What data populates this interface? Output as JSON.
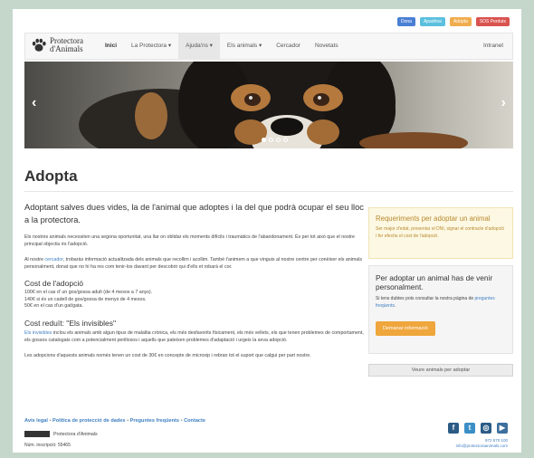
{
  "top_pills": [
    {
      "label": "Dona",
      "color": "#4a7fd4"
    },
    {
      "label": "Apadrina",
      "color": "#5bc0de"
    },
    {
      "label": "Adopta",
      "color": "#f0ad4e"
    },
    {
      "label": "SOS Perduts",
      "color": "#d9534f"
    }
  ],
  "brand": {
    "line1": "Protectora",
    "line2": "d'Animals"
  },
  "nav": {
    "items": [
      "Inici",
      "La Protectora ▾",
      "Ajuda'ns ▾",
      "Els animals ▾",
      "Cercador",
      "Novetats"
    ],
    "right": "Intranet"
  },
  "hero": {
    "prev": "‹",
    "next": "›"
  },
  "page_title": "Adopta",
  "main": {
    "lead": "Adoptant salves dues vides, la de l'animal que adoptes i la del que podrà ocupar el seu lloc a la protectora.",
    "intro": "Els nostres animals necessiten una segona oportunitat, una llar on oblidar els moments difícils i traumàtics de l'abandonament. És per tot això que el nostre principal objectiu és l'adopció.",
    "search_p_before": "Al nostre",
    "search_link": "cercador",
    "search_p_after": ", trobaràs informació actualitzada dels animals que recollim i acollim. També t'animem a que vinguis al nostre centre per conèixer els animals personalment, donat que no hi ha res com tenir-los davant per descobrir qui d'ells et robarà el cor.",
    "cost_title": "Cost de l'adopció",
    "cost_lines": [
      "100€ en el cas d' un gos/gossa adult (de 4 mesos a 7 anys).",
      "140€ si és un cadell de gos/gossa de menys de 4 mesos.",
      "50€ en el cas d'un gat/gata."
    ],
    "invisible_title": "Cost reduït: \"Els invisibles\"",
    "invisible_link": "Els invisibles",
    "invisible_text": " inclou els animals amb algun tipus de malaltia crònica, els més desfavorits físicament, els més vellets, els que tenen problemes de comportament, els gossos catalogats com a potencialment perillosos i aquells que pateixen problemes d'adaptació i urgeix la seva adopció.",
    "invisible_cost": "Les adopcions d'aquests animals només tenen un cost de 30€ en concepte de microxip i rebran tot el suport que calgui per part nostre."
  },
  "requirements": {
    "title": "Requeriments per adoptar un animal",
    "body": "Ser major d'edat, presentar el DNI, signar el contracte d'adopció i fer efectiu el cost de l'adopció."
  },
  "adopt_panel": {
    "title": "Per adoptar un animal has de venir personalment.",
    "body_before": "Si tens dubtes pots consultar la nostra pàgina de ",
    "body_link": "preguntes freqüents",
    "body_after": ".",
    "button": "Demanar informació"
  },
  "see_animals_button": "Veure animals per adoptar",
  "footer": {
    "links": [
      "Avís legal",
      "Política de protecció de dades",
      "Preguntes freqüents",
      "Contacte"
    ],
    "org": "Protectora d'Animals",
    "reg": "Núm. inscripció: 55465",
    "phone": "972 570 100",
    "email": "info@protectoraanimals.com",
    "social": [
      "f",
      "t",
      "◎",
      "▶"
    ]
  },
  "colors": {
    "link": "#3e7fc1",
    "warning_bg": "#fcf8e3",
    "warning_text": "#b9892f",
    "button_orange": "#efa63c"
  }
}
